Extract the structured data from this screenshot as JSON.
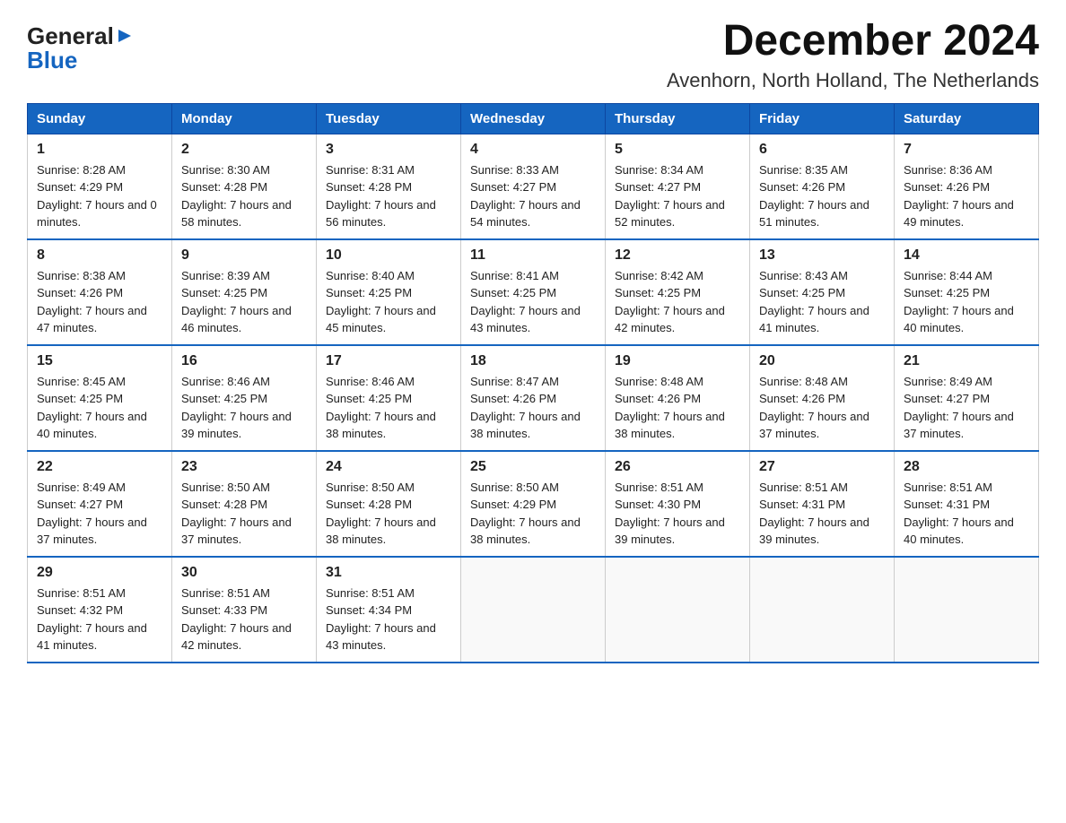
{
  "header": {
    "title": "December 2024",
    "subtitle": "Avenhorn, North Holland, The Netherlands",
    "logo_general": "General",
    "logo_blue": "Blue"
  },
  "calendar": {
    "weekdays": [
      "Sunday",
      "Monday",
      "Tuesday",
      "Wednesday",
      "Thursday",
      "Friday",
      "Saturday"
    ],
    "weeks": [
      [
        {
          "day": "1",
          "sunrise": "8:28 AM",
          "sunset": "4:29 PM",
          "daylight": "7 hours and 0 minutes."
        },
        {
          "day": "2",
          "sunrise": "8:30 AM",
          "sunset": "4:28 PM",
          "daylight": "7 hours and 58 minutes."
        },
        {
          "day": "3",
          "sunrise": "8:31 AM",
          "sunset": "4:28 PM",
          "daylight": "7 hours and 56 minutes."
        },
        {
          "day": "4",
          "sunrise": "8:33 AM",
          "sunset": "4:27 PM",
          "daylight": "7 hours and 54 minutes."
        },
        {
          "day": "5",
          "sunrise": "8:34 AM",
          "sunset": "4:27 PM",
          "daylight": "7 hours and 52 minutes."
        },
        {
          "day": "6",
          "sunrise": "8:35 AM",
          "sunset": "4:26 PM",
          "daylight": "7 hours and 51 minutes."
        },
        {
          "day": "7",
          "sunrise": "8:36 AM",
          "sunset": "4:26 PM",
          "daylight": "7 hours and 49 minutes."
        }
      ],
      [
        {
          "day": "8",
          "sunrise": "8:38 AM",
          "sunset": "4:26 PM",
          "daylight": "7 hours and 47 minutes."
        },
        {
          "day": "9",
          "sunrise": "8:39 AM",
          "sunset": "4:25 PM",
          "daylight": "7 hours and 46 minutes."
        },
        {
          "day": "10",
          "sunrise": "8:40 AM",
          "sunset": "4:25 PM",
          "daylight": "7 hours and 45 minutes."
        },
        {
          "day": "11",
          "sunrise": "8:41 AM",
          "sunset": "4:25 PM",
          "daylight": "7 hours and 43 minutes."
        },
        {
          "day": "12",
          "sunrise": "8:42 AM",
          "sunset": "4:25 PM",
          "daylight": "7 hours and 42 minutes."
        },
        {
          "day": "13",
          "sunrise": "8:43 AM",
          "sunset": "4:25 PM",
          "daylight": "7 hours and 41 minutes."
        },
        {
          "day": "14",
          "sunrise": "8:44 AM",
          "sunset": "4:25 PM",
          "daylight": "7 hours and 40 minutes."
        }
      ],
      [
        {
          "day": "15",
          "sunrise": "8:45 AM",
          "sunset": "4:25 PM",
          "daylight": "7 hours and 40 minutes."
        },
        {
          "day": "16",
          "sunrise": "8:46 AM",
          "sunset": "4:25 PM",
          "daylight": "7 hours and 39 minutes."
        },
        {
          "day": "17",
          "sunrise": "8:46 AM",
          "sunset": "4:25 PM",
          "daylight": "7 hours and 38 minutes."
        },
        {
          "day": "18",
          "sunrise": "8:47 AM",
          "sunset": "4:26 PM",
          "daylight": "7 hours and 38 minutes."
        },
        {
          "day": "19",
          "sunrise": "8:48 AM",
          "sunset": "4:26 PM",
          "daylight": "7 hours and 38 minutes."
        },
        {
          "day": "20",
          "sunrise": "8:48 AM",
          "sunset": "4:26 PM",
          "daylight": "7 hours and 37 minutes."
        },
        {
          "day": "21",
          "sunrise": "8:49 AM",
          "sunset": "4:27 PM",
          "daylight": "7 hours and 37 minutes."
        }
      ],
      [
        {
          "day": "22",
          "sunrise": "8:49 AM",
          "sunset": "4:27 PM",
          "daylight": "7 hours and 37 minutes."
        },
        {
          "day": "23",
          "sunrise": "8:50 AM",
          "sunset": "4:28 PM",
          "daylight": "7 hours and 37 minutes."
        },
        {
          "day": "24",
          "sunrise": "8:50 AM",
          "sunset": "4:28 PM",
          "daylight": "7 hours and 38 minutes."
        },
        {
          "day": "25",
          "sunrise": "8:50 AM",
          "sunset": "4:29 PM",
          "daylight": "7 hours and 38 minutes."
        },
        {
          "day": "26",
          "sunrise": "8:51 AM",
          "sunset": "4:30 PM",
          "daylight": "7 hours and 39 minutes."
        },
        {
          "day": "27",
          "sunrise": "8:51 AM",
          "sunset": "4:31 PM",
          "daylight": "7 hours and 39 minutes."
        },
        {
          "day": "28",
          "sunrise": "8:51 AM",
          "sunset": "4:31 PM",
          "daylight": "7 hours and 40 minutes."
        }
      ],
      [
        {
          "day": "29",
          "sunrise": "8:51 AM",
          "sunset": "4:32 PM",
          "daylight": "7 hours and 41 minutes."
        },
        {
          "day": "30",
          "sunrise": "8:51 AM",
          "sunset": "4:33 PM",
          "daylight": "7 hours and 42 minutes."
        },
        {
          "day": "31",
          "sunrise": "8:51 AM",
          "sunset": "4:34 PM",
          "daylight": "7 hours and 43 minutes."
        },
        null,
        null,
        null,
        null
      ]
    ]
  }
}
